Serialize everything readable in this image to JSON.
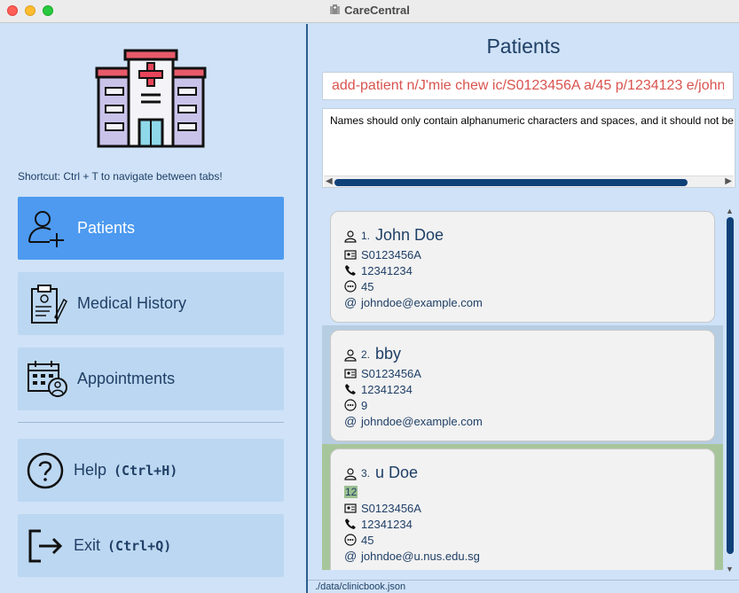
{
  "window": {
    "title": "CareCentral"
  },
  "sidebar": {
    "shortcut_hint": "Shortcut: Ctrl + T to navigate between tabs!",
    "tabs": [
      {
        "label": "Patients",
        "icon": "add-user-icon",
        "active": true
      },
      {
        "label": "Medical History",
        "icon": "clipboard-icon",
        "active": false
      },
      {
        "label": "Appointments",
        "icon": "calendar-person-icon",
        "active": false
      }
    ],
    "actions": [
      {
        "label": "Help",
        "shortcut": "(Ctrl+H)",
        "icon": "question-icon"
      },
      {
        "label": "Exit",
        "shortcut": "(Ctrl+Q)",
        "icon": "exit-icon"
      }
    ]
  },
  "main": {
    "title": "Patients",
    "command_value": "add-patient n/J'mie chew ic/S0123456A a/45 p/1234123 e/johndoe",
    "result_text": "Names should only contain alphanumeric characters and spaces, and it should not be blank",
    "patients": [
      {
        "index": "1.",
        "name": "John Doe",
        "tags": [],
        "ic": "S0123456A",
        "phone": "12341234",
        "age": "45",
        "email": "johndoe@example.com"
      },
      {
        "index": "2.",
        "name": "bby",
        "tags": [],
        "ic": "S0123456A",
        "phone": "12341234",
        "age": "9",
        "email": "johndoe@example.com"
      },
      {
        "index": "3.",
        "name": "u Doe",
        "tags": [
          "12"
        ],
        "ic": "S0123456A",
        "phone": "12341234",
        "age": "45",
        "email": "johndoe@u.nus.edu.sg"
      }
    ],
    "status_path": "./data/clinicbook.json"
  },
  "colors": {
    "accent": "#4d9af0",
    "error": "#d9534f",
    "text": "#1f3f66",
    "selected_row": "#a7c59a"
  }
}
